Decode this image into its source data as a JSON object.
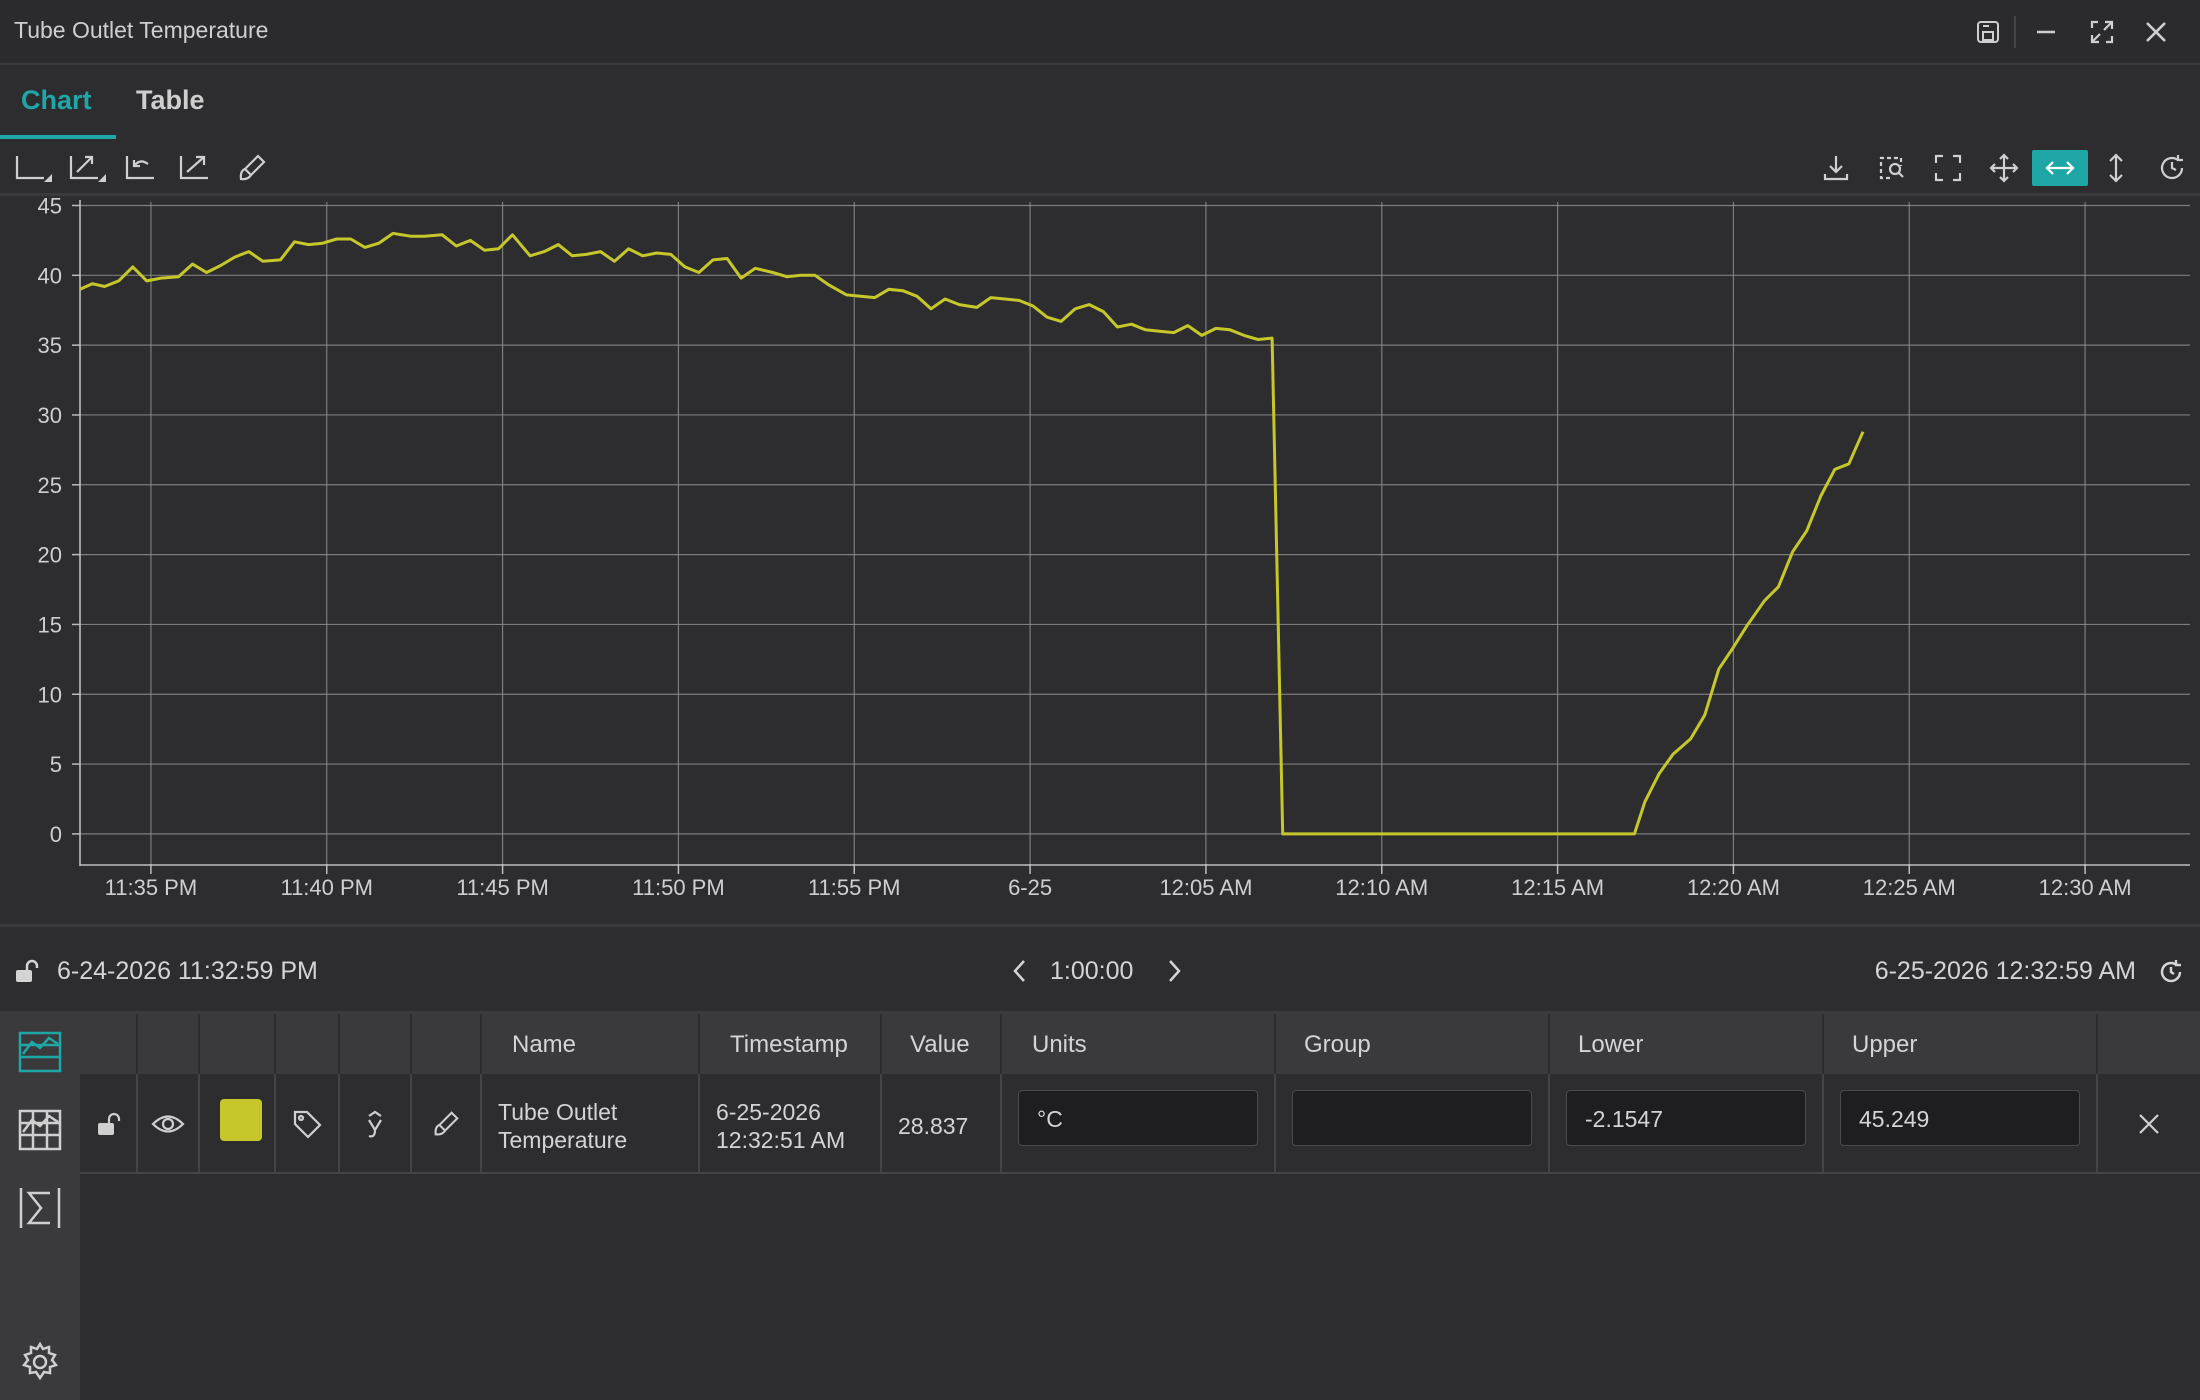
{
  "window": {
    "title": "Tube Outlet Temperature",
    "icons": [
      "save-icon",
      "minimize-icon",
      "maximize-icon",
      "close-icon"
    ]
  },
  "tabs": [
    {
      "label": "Chart",
      "active": true
    },
    {
      "label": "Table",
      "active": false
    }
  ],
  "toolbar": {
    "left_icons": [
      "axis-scale-icon",
      "zoom-extents-icon",
      "undo-zoom-icon",
      "trend-icon",
      "brush-icon"
    ],
    "right_icons": [
      "download-icon",
      "zoom-box-icon",
      "fullscreen-icon",
      "pan-icon",
      "horizontal-scale-icon",
      "vertical-scale-icon",
      "refresh-icon"
    ],
    "active_tool": "horizontal-scale-icon"
  },
  "colors": {
    "accent": "#1fa7a7",
    "series": "#c6c72a",
    "background": "#2d2d30",
    "grid": "#8a8a8a"
  },
  "chart_data": {
    "type": "line",
    "title": "",
    "xlabel": "",
    "ylabel": "",
    "ylim": [
      -2.1547,
      45.249
    ],
    "yticks": [
      0,
      5,
      10,
      15,
      20,
      25,
      30,
      35,
      40,
      45
    ],
    "x_start": "6-24-2026 11:32:59 PM",
    "x_end": "6-25-2026 12:32:59 AM",
    "x_ticks": [
      {
        "minute": 2.0167,
        "label": "11:35 PM"
      },
      {
        "minute": 7.0167,
        "label": "11:40 PM"
      },
      {
        "minute": 12.0167,
        "label": "11:45 PM"
      },
      {
        "minute": 17.0167,
        "label": "11:50 PM"
      },
      {
        "minute": 22.0167,
        "label": "11:55 PM"
      },
      {
        "minute": 27.0167,
        "label": "6-25"
      },
      {
        "minute": 32.0167,
        "label": "12:05 AM"
      },
      {
        "minute": 37.0167,
        "label": "12:10 AM"
      },
      {
        "minute": 42.0167,
        "label": "12:15 AM"
      },
      {
        "minute": 47.0167,
        "label": "12:20 AM"
      },
      {
        "minute": 52.0167,
        "label": "12:25 AM"
      },
      {
        "minute": 57.0167,
        "label": "12:30 AM"
      }
    ],
    "grid": true,
    "legend": "none",
    "series": [
      {
        "name": "Tube Outlet Temperature",
        "points": [
          [
            0.0,
            39.0
          ],
          [
            0.35,
            39.4
          ],
          [
            0.7,
            39.2
          ],
          [
            1.1,
            39.6
          ],
          [
            1.5,
            40.6
          ],
          [
            1.9,
            39.6
          ],
          [
            2.3,
            39.8
          ],
          [
            2.8,
            39.9
          ],
          [
            3.2,
            40.8
          ],
          [
            3.6,
            40.2
          ],
          [
            4.0,
            40.7
          ],
          [
            4.4,
            41.3
          ],
          [
            4.8,
            41.7
          ],
          [
            5.2,
            41.0
          ],
          [
            5.7,
            41.1
          ],
          [
            6.1,
            42.4
          ],
          [
            6.5,
            42.2
          ],
          [
            6.9,
            42.3
          ],
          [
            7.3,
            42.6
          ],
          [
            7.7,
            42.6
          ],
          [
            8.1,
            42.0
          ],
          [
            8.5,
            42.3
          ],
          [
            8.9,
            43.0
          ],
          [
            9.4,
            42.8
          ],
          [
            9.8,
            42.8
          ],
          [
            10.3,
            42.9
          ],
          [
            10.7,
            42.1
          ],
          [
            11.1,
            42.5
          ],
          [
            11.5,
            41.8
          ],
          [
            11.9,
            41.9
          ],
          [
            12.3,
            42.9
          ],
          [
            12.8,
            41.4
          ],
          [
            13.2,
            41.7
          ],
          [
            13.6,
            42.2
          ],
          [
            14.0,
            41.4
          ],
          [
            14.4,
            41.5
          ],
          [
            14.8,
            41.7
          ],
          [
            15.2,
            41.0
          ],
          [
            15.6,
            41.9
          ],
          [
            16.0,
            41.4
          ],
          [
            16.4,
            41.6
          ],
          [
            16.8,
            41.5
          ],
          [
            17.2,
            40.6
          ],
          [
            17.6,
            40.2
          ],
          [
            18.0,
            41.1
          ],
          [
            18.4,
            41.2
          ],
          [
            18.8,
            39.8
          ],
          [
            19.2,
            40.5
          ],
          [
            19.7,
            40.2
          ],
          [
            20.1,
            39.9
          ],
          [
            20.5,
            40.0
          ],
          [
            20.9,
            40.0
          ],
          [
            21.3,
            39.3
          ],
          [
            21.8,
            38.6
          ],
          [
            22.2,
            38.5
          ],
          [
            22.6,
            38.4
          ],
          [
            23.0,
            39.0
          ],
          [
            23.4,
            38.9
          ],
          [
            23.8,
            38.5
          ],
          [
            24.2,
            37.6
          ],
          [
            24.6,
            38.3
          ],
          [
            25.0,
            37.9
          ],
          [
            25.5,
            37.7
          ],
          [
            25.9,
            38.4
          ],
          [
            26.3,
            38.3
          ],
          [
            26.7,
            38.2
          ],
          [
            27.1,
            37.8
          ],
          [
            27.5,
            37.0
          ],
          [
            27.9,
            36.7
          ],
          [
            28.3,
            37.6
          ],
          [
            28.7,
            37.9
          ],
          [
            29.1,
            37.4
          ],
          [
            29.5,
            36.3
          ],
          [
            29.9,
            36.5
          ],
          [
            30.3,
            36.1
          ],
          [
            30.7,
            36.0
          ],
          [
            31.1,
            35.9
          ],
          [
            31.5,
            36.4
          ],
          [
            31.9,
            35.7
          ],
          [
            32.3,
            36.2
          ],
          [
            32.7,
            36.1
          ],
          [
            33.1,
            35.7
          ],
          [
            33.5,
            35.4
          ],
          [
            33.9,
            35.5
          ],
          [
            34.2,
            0.0
          ],
          [
            44.2,
            0.0
          ],
          [
            44.5,
            2.3
          ],
          [
            44.9,
            4.3
          ],
          [
            45.3,
            5.7
          ],
          [
            45.8,
            6.8
          ],
          [
            46.2,
            8.5
          ],
          [
            46.6,
            11.8
          ],
          [
            47.0,
            13.3
          ],
          [
            47.4,
            14.9
          ],
          [
            47.9,
            16.7
          ],
          [
            48.3,
            17.7
          ],
          [
            48.7,
            20.2
          ],
          [
            49.1,
            21.7
          ],
          [
            49.5,
            24.2
          ],
          [
            49.9,
            26.1
          ],
          [
            50.3,
            26.5
          ],
          [
            50.7,
            28.8
          ]
        ]
      }
    ]
  },
  "range_bar": {
    "start": "6-24-2026 11:32:59 PM",
    "duration": "1:00:00",
    "end": "6-25-2026 12:32:59 AM"
  },
  "grid": {
    "headers": {
      "name": "Name",
      "timestamp": "Timestamp",
      "value": "Value",
      "units": "Units",
      "group": "Group",
      "lower": "Lower",
      "upper": "Upper"
    },
    "row": {
      "name_line1": "Tube Outlet",
      "name_line2": "Temperature",
      "timestamp_line1": "6-25-2026",
      "timestamp_line2": "12:32:51 AM",
      "value": "28.837",
      "units": "°C",
      "group": "",
      "lower": "-2.1547",
      "upper": "45.249",
      "color": "#c6c72a"
    }
  }
}
